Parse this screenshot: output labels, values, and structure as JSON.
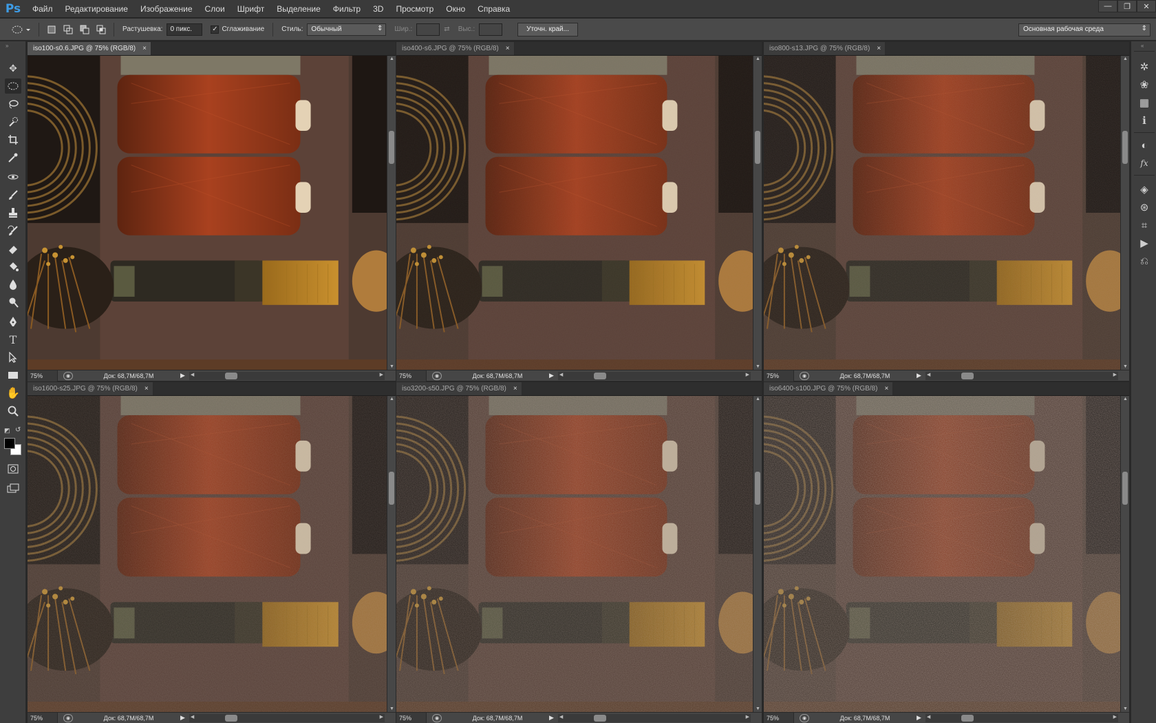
{
  "app": {
    "logo": "Ps"
  },
  "menu": [
    "Файл",
    "Редактирование",
    "Изображение",
    "Слои",
    "Шрифт",
    "Выделение",
    "Фильтр",
    "3D",
    "Просмотр",
    "Окно",
    "Справка"
  ],
  "window_controls": {
    "minimize": "—",
    "restore": "❐",
    "close": "✕"
  },
  "options": {
    "feather_label": "Растушевка:",
    "feather_value": "0 пикс.",
    "antialias_label": "Сглаживание",
    "antialias_checked": true,
    "style_label": "Стиль:",
    "style_value": "Обычный",
    "width_label": "Шир.:",
    "height_label": "Выс.:",
    "refine_button": "Уточн. край...",
    "workspace": "Основная рабочая среда"
  },
  "documents": [
    {
      "title": "iso100-s0.6.JPG @ 75% (RGB/8)",
      "zoom": "75%",
      "doc_info": "Док: 68,7M/68,7M",
      "noise": 0,
      "active": true
    },
    {
      "title": "iso400-s6.JPG @ 75% (RGB/8)",
      "zoom": "75%",
      "doc_info": "Док: 68,7M/68,7M",
      "noise": 0.15,
      "active": false
    },
    {
      "title": "iso800-s13.JPG @ 75% (RGB/8)",
      "zoom": "75%",
      "doc_info": "Док: 68,7M/68,7M",
      "noise": 0.3,
      "active": false
    },
    {
      "title": "iso1600-s25.JPG @ 75% (RGB/8)",
      "zoom": "75%",
      "doc_info": "Док: 68,7M/68,7M",
      "noise": 0.45,
      "active": false
    },
    {
      "title": "iso3200-s50.JPG @ 75% (RGB/8)",
      "zoom": "75%",
      "doc_info": "Док: 68,7M/68,7M",
      "noise": 0.65,
      "active": false
    },
    {
      "title": "iso6400-s100.JPG @ 75% (RGB/8)",
      "zoom": "75%",
      "doc_info": "Док: 68,7M/68,7M",
      "noise": 0.9,
      "active": false
    }
  ],
  "tools": [
    "move-tool",
    "elliptical-marquee-tool",
    "lasso-tool",
    "quick-selection-tool",
    "crop-tool",
    "eyedropper-tool",
    "spot-healing-tool",
    "brush-tool",
    "clone-stamp-tool",
    "history-brush-tool",
    "eraser-tool",
    "paint-bucket-tool",
    "blur-tool",
    "dodge-tool",
    "pen-tool",
    "type-tool",
    "path-selection-tool",
    "rectangle-tool",
    "hand-tool",
    "zoom-tool"
  ],
  "dock_panels": [
    "navigator",
    "color-swatches",
    "grid",
    "info",
    "adjustments",
    "styles",
    "layers",
    "channels",
    "paths",
    "actions",
    "history"
  ],
  "colors": {
    "foreground": "#000000",
    "background": "#ffffff",
    "accent": "#3d9ce6"
  }
}
